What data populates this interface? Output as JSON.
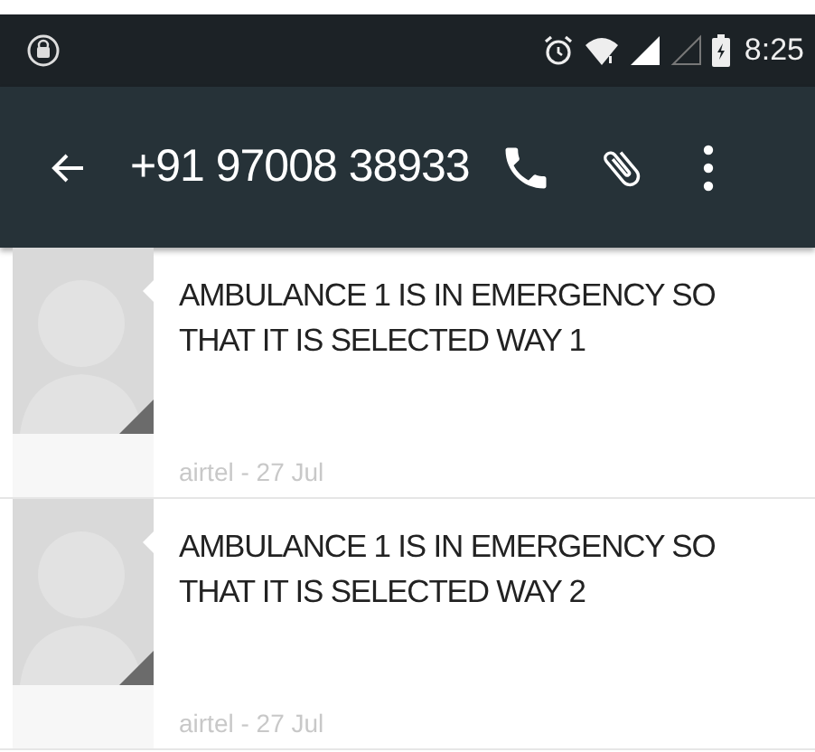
{
  "status_bar": {
    "time": "8:25"
  },
  "toolbar": {
    "title": "+91 97008 38933"
  },
  "messages": [
    {
      "text": "AMBULANCE 1 IS IN EMERGENCY SO THAT IT IS SELECTED WAY 1",
      "meta": "airtel - 27 Jul"
    },
    {
      "text": "AMBULANCE 1 IS IN EMERGENCY SO THAT IT IS SELECTED WAY 2",
      "meta": "airtel - 27 Jul"
    }
  ]
}
